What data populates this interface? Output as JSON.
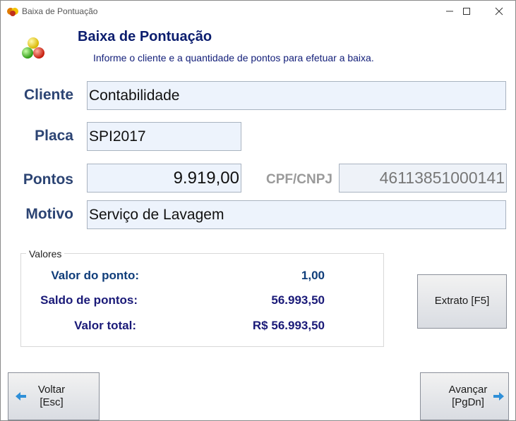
{
  "window": {
    "title": "Baixa de Pontuação"
  },
  "header": {
    "title": "Baixa de Pontuação",
    "subtitle": "Informe o cliente e a quantidade de pontos para efetuar a baixa."
  },
  "form": {
    "cliente_label": "Cliente",
    "cliente_value": "Contabilidade",
    "placa_label": "Placa",
    "placa_value": "SPI2017",
    "pontos_label": "Pontos",
    "pontos_value": "9.919,00",
    "cpf_label": "CPF/CNPJ",
    "cpf_value": "46113851000141",
    "motivo_label": "Motivo",
    "motivo_value": "Serviço de Lavagem"
  },
  "valores": {
    "title": "Valores",
    "valor_ponto_label": "Valor do ponto:",
    "valor_ponto_value": "1,00",
    "saldo_label": "Saldo de pontos:",
    "saldo_value": "56.993,50",
    "total_label": "Valor total:",
    "total_value": "R$ 56.993,50"
  },
  "buttons": {
    "extrato_label": "Extrato [F5]",
    "voltar_line1": "Voltar",
    "voltar_line2": "[Esc]",
    "avancar_line1": "Avançar",
    "avancar_line2": "[PgDn]"
  },
  "colors": {
    "label": "#2c4473",
    "header": "#0b1d6e",
    "value_blue": "#0f3d7a",
    "value_navy": "#1a1a78",
    "field_bg": "#edf3fc"
  },
  "icons": [
    "app-icon",
    "minimize-icon",
    "maximize-icon",
    "close-icon",
    "colored-balls-icon",
    "arrow-left-icon",
    "arrow-right-icon"
  ]
}
